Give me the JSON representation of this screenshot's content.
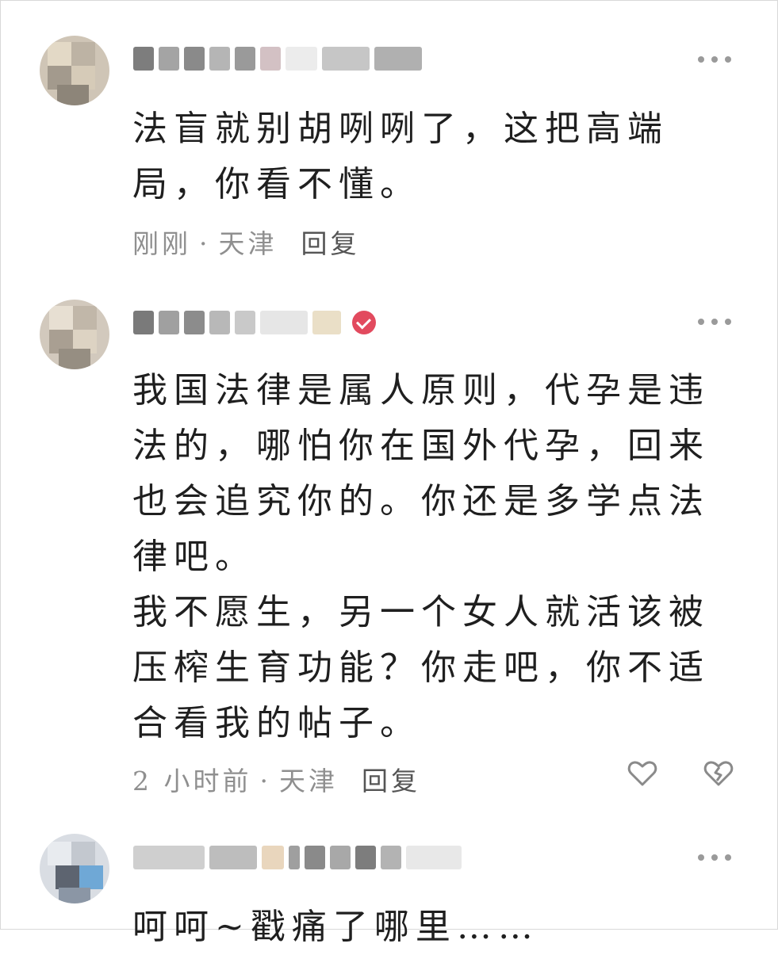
{
  "comments": [
    {
      "text_lines": [
        "法盲就别胡咧咧了，这把高端",
        "局，你看不懂。"
      ],
      "time": "刚刚",
      "location": "天津",
      "reply_label": "回复"
    },
    {
      "text_lines": [
        "我国法律是属人原则，代孕是违",
        "法的，哪怕你在国外代孕，回来",
        "也会追究你的。你还是多学点法",
        "律吧。",
        "我不愿生，另一个女人就活该被",
        "压榨生育功能？你走吧，你不适",
        "合看我的帖子。"
      ],
      "time": "2 小时前",
      "location": "天津",
      "reply_label": "回复",
      "verified_badge": "verified-check-icon",
      "like_icon": "heart-icon",
      "dislike_icon": "broken-heart-icon"
    },
    {
      "text_lines": [
        "呵呵~戳痛了哪里……"
      ]
    }
  ],
  "meta_separator": "·",
  "colors": {
    "meta_gray": "#8f8f8f",
    "badge_red": "#e24a5e",
    "icon_gray": "#8a8a8a"
  }
}
